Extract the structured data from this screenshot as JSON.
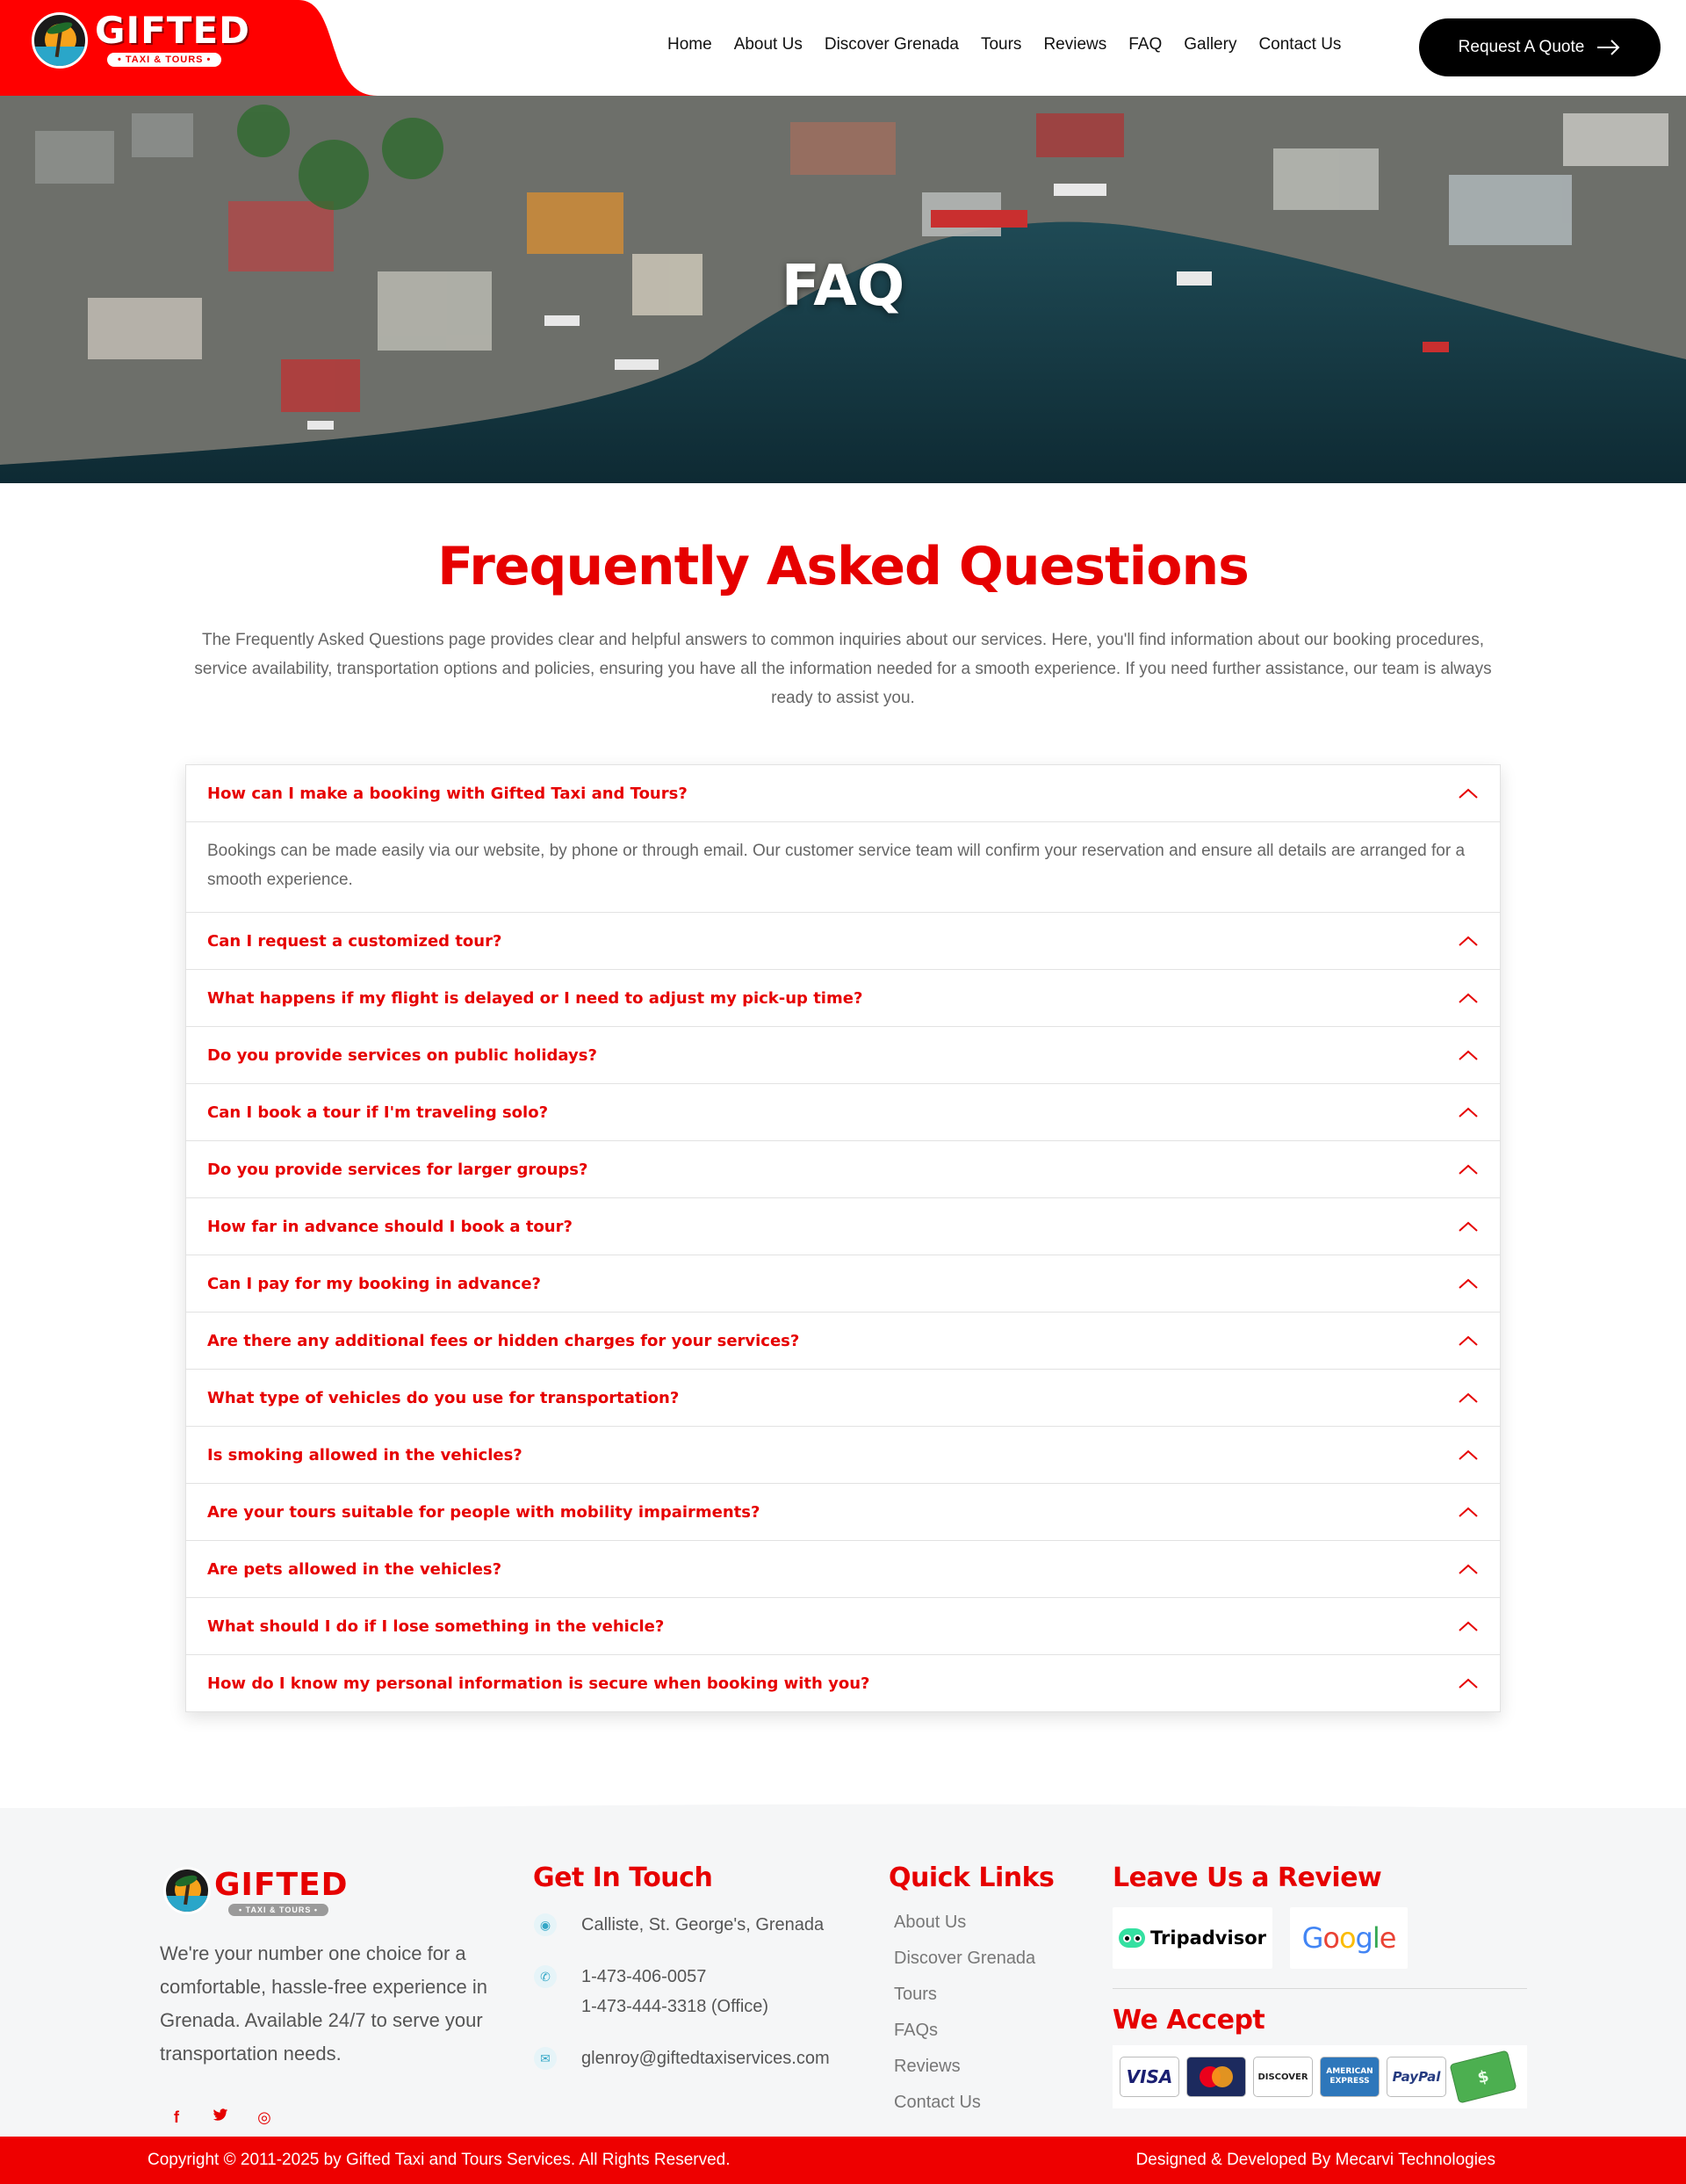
{
  "brand": {
    "name": "GIFTED",
    "tagline": "• TAXI & TOURS •",
    "accent_color": "#e60000"
  },
  "nav": {
    "items": [
      "Home",
      "About Us",
      "Discover Grenada",
      "Tours",
      "Reviews",
      "FAQ",
      "Gallery",
      "Contact Us"
    ],
    "quote_button": "Request A Quote"
  },
  "hero": {
    "title": "FAQ"
  },
  "faq": {
    "heading": "Frequently Asked Questions",
    "intro": "The Frequently Asked Questions page provides clear and helpful answers to common inquiries about our services. Here, you'll find information about our booking procedures, service availability, transportation options and policies, ensuring you have all the information needed for a smooth experience. If you need further assistance, our team is always ready to assist you.",
    "items": [
      {
        "q": "How can I make a booking with Gifted Taxi and Tours?",
        "a": "Bookings can be made easily via our website, by phone or through email. Our customer service team will confirm your reservation and ensure all details are arranged for a smooth experience.",
        "open": true
      },
      {
        "q": "Can I request a customized tour?"
      },
      {
        "q": "What happens if my flight is delayed or I need to adjust my pick-up time?"
      },
      {
        "q": "Do you provide services on public holidays?"
      },
      {
        "q": "Can I book a tour if I'm traveling solo?"
      },
      {
        "q": "Do you provide services for larger groups?"
      },
      {
        "q": "How far in advance should I book a tour?"
      },
      {
        "q": "Can I pay for my booking in advance?"
      },
      {
        "q": "Are there any additional fees or hidden charges for your services?"
      },
      {
        "q": "What type of vehicles do you use for transportation?"
      },
      {
        "q": "Is smoking allowed in the vehicles?"
      },
      {
        "q": "Are your tours suitable for people with mobility impairments?"
      },
      {
        "q": "Are pets allowed in the vehicles?"
      },
      {
        "q": "What should I do if I lose something in the vehicle?"
      },
      {
        "q": "How do I know my personal information is secure when booking with you?"
      }
    ]
  },
  "footer": {
    "about": "We're your number one choice for a comfortable, hassle-free experience in Grenada. Available 24/7 to serve your transportation needs.",
    "social": [
      {
        "icon": "facebook-icon",
        "glyph": "f"
      },
      {
        "icon": "twitter-icon",
        "glyph": "t"
      },
      {
        "icon": "instagram-icon",
        "glyph": "◎"
      }
    ],
    "contact": {
      "heading": "Get In Touch",
      "address": "Calliste, St. George's, Grenada",
      "phone1": "1-473-406-0057",
      "phone2": "1-473-444-3318 (Office)",
      "email": "glenroy@giftedtaxiservices.com"
    },
    "quick_links": {
      "heading": "Quick Links",
      "items": [
        "About Us",
        "Discover Grenada",
        "Tours",
        "FAQs",
        "Reviews",
        "Contact Us"
      ]
    },
    "review": {
      "heading": "Leave Us a Review",
      "tripadvisor": "Tripadvisor",
      "google": "Google"
    },
    "accept": {
      "heading": "We Accept",
      "cards": [
        "VISA",
        "MasterCard",
        "DISCOVER",
        "AMERICAN EXPRESS",
        "PayPal",
        "Cash"
      ]
    },
    "copyright": "Copyright © 2011-2025 by Gifted Taxi and Tours Services. All Rights Reserved.",
    "credit": "Designed & Developed By Mecarvi Technologies"
  }
}
